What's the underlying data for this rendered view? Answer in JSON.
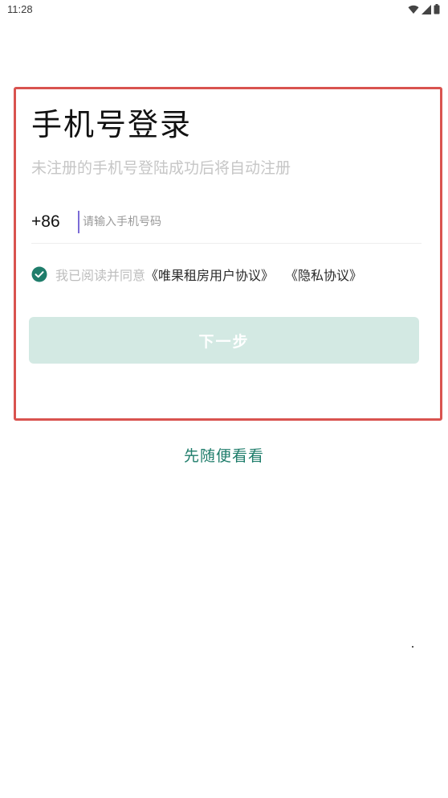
{
  "status_bar": {
    "time": "11:28",
    "icons": [
      "wifi-icon",
      "signal-icon",
      "battery-icon"
    ]
  },
  "login": {
    "title": "手机号登录",
    "subtitle": "未注册的手机号登陆成功后将自动注册",
    "country_code": "+86",
    "phone_placeholder": "请输入手机号码",
    "phone_value": "",
    "agreement": {
      "prefix": "我已阅读并同意",
      "user_agreement": "《唯果租房用户协议》",
      "privacy_policy": "《隐私协议》",
      "checked": true
    },
    "next_label": "下一步"
  },
  "browse_label": "先随便看看",
  "colors": {
    "accent": "#1f7d6b",
    "button_disabled": "#d3e9e3",
    "highlight_border": "#d9534f"
  }
}
